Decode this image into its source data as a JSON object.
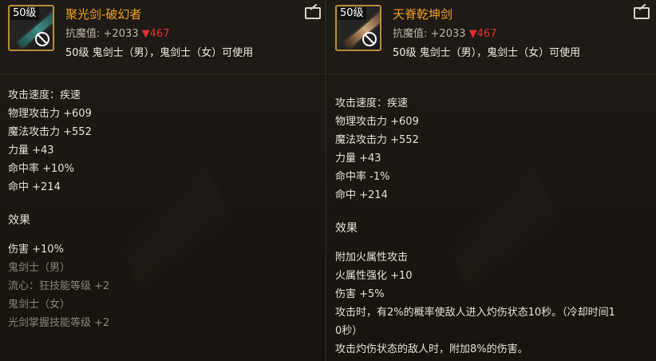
{
  "items": [
    {
      "id": "left",
      "level_badge": "50级",
      "name": "聚光剑-破幻者",
      "enhance_label": "抗魔值:",
      "enhance_value": "+2033",
      "enhance_down": "▼467",
      "requirement": "50级 鬼剑士（男），鬼剑士（女）可使用",
      "stats": [
        "攻击速度：疾速",
        "物理攻击力 +609",
        "魔法攻击力 +552",
        "力量 +43",
        "命中率 +10%",
        "命中 +214"
      ],
      "effect_title": "效果",
      "effects": [
        {
          "text": "伤害 +10%",
          "active": true
        },
        {
          "text": "鬼剑士（男）",
          "active": false
        },
        {
          "text": "流心：狂技能等级 +2",
          "active": false
        },
        {
          "text": "鬼剑士（女）",
          "active": false
        },
        {
          "text": "光剑掌握技能等级 +2",
          "active": false
        }
      ]
    },
    {
      "id": "right",
      "level_badge": "50级",
      "name": "天脊乾坤剑",
      "enhance_label": "抗魔值:",
      "enhance_value": "+2033",
      "enhance_down": "▼467",
      "requirement": "50级 鬼剑士（男），鬼剑士（女）可使用",
      "stats": [
        "攻击速度：疾速",
        "物理攻击力 +609",
        "魔法攻击力 +552",
        "力量 +43",
        "命中率 -1%",
        "命中 +214"
      ],
      "effect_title": "效果",
      "effects": [
        {
          "text": "附加火属性攻击",
          "active": true
        },
        {
          "text": "火属性强化 +10",
          "active": true
        },
        {
          "text": "伤害 +5%",
          "active": true
        },
        {
          "text": "攻击时，有2%的概率使敌人进入灼伤状态10秒。（冷却时间1",
          "active": true
        },
        {
          "text": "0秒）",
          "active": true
        },
        {
          "text": "攻击灼伤状态的敌人时，附加8%的伤害。",
          "active": true
        }
      ]
    }
  ],
  "colors": {
    "item_name": "#f0a020",
    "enhance_down": "#e03030",
    "inactive_text": "#8a8479",
    "icon_border": "#b88d3c"
  },
  "icons": {
    "share": "share-icon",
    "unusable": "prohibited-icon"
  }
}
